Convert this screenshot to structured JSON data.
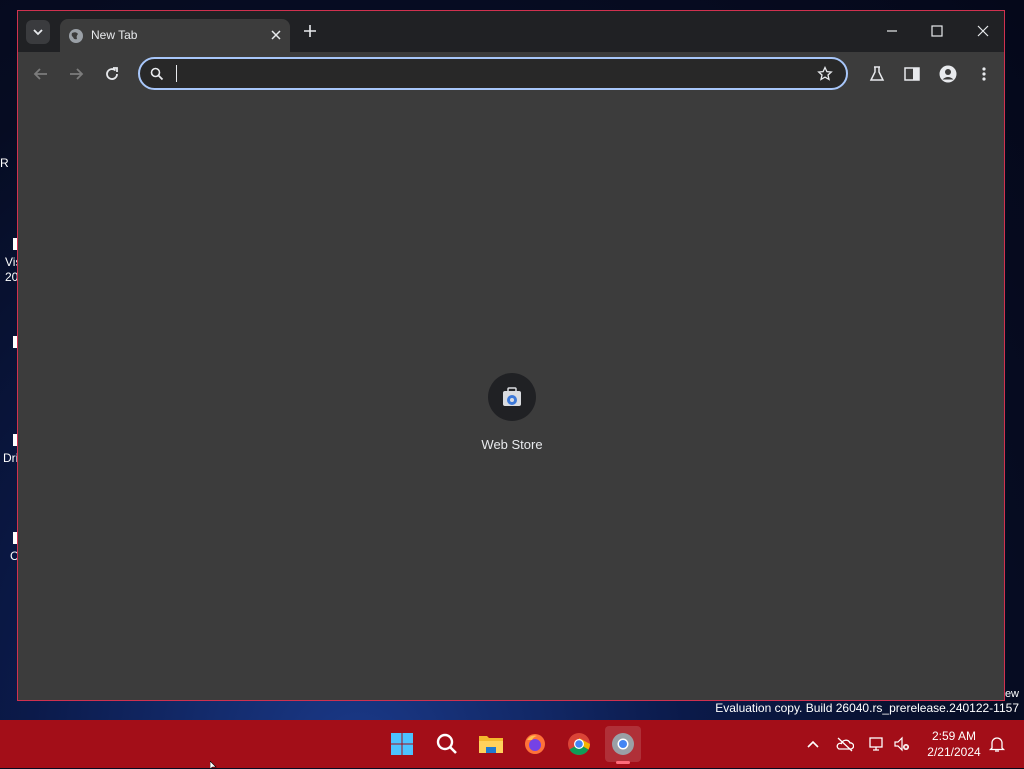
{
  "desktop": {
    "fragments": [
      "R",
      "Vis",
      "20",
      "Dri",
      "C"
    ]
  },
  "browser": {
    "tab": {
      "title": "New Tab",
      "favicon": "globe-icon"
    },
    "omnibox": {
      "value": "",
      "placeholder": ""
    },
    "shortcuts": [
      {
        "label": "Web Store",
        "icon": "web-store-icon"
      }
    ],
    "colors": {
      "frame": "#202124",
      "toolbar": "#3c3c3c",
      "focus_ring": "#a8c7fa"
    }
  },
  "watermark": {
    "line_edge": "ew",
    "line": "Evaluation copy. Build 26040.rs_prerelease.240122-1157"
  },
  "taskbar": {
    "color": "#a30e18",
    "apps": [
      "start-icon",
      "search-icon",
      "file-explorer-icon",
      "firefox-icon",
      "chrome-icon",
      "chrome-dev-icon"
    ],
    "clock": {
      "time": "2:59 AM",
      "date": "2/21/2024"
    }
  }
}
